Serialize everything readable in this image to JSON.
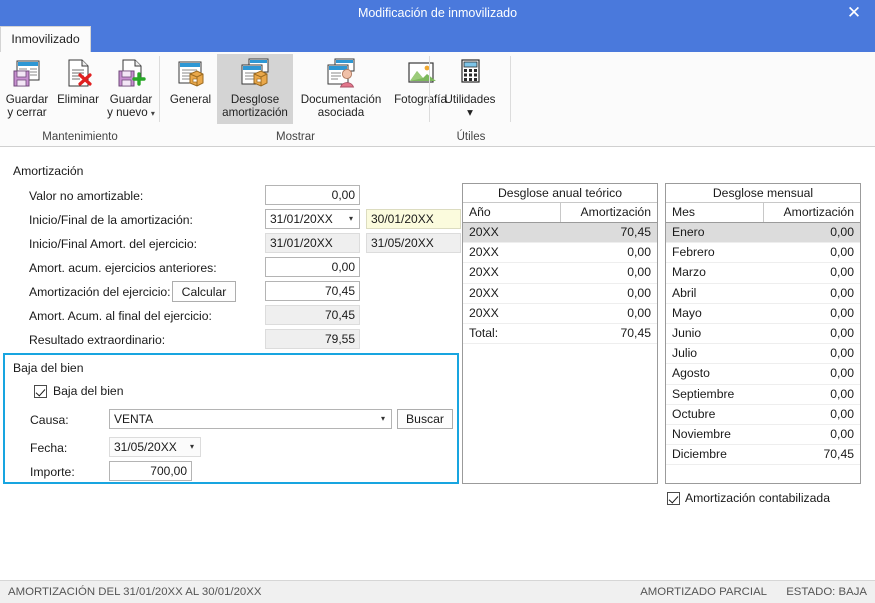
{
  "window": {
    "title": "Modificación de inmovilizado",
    "close_label": "✕"
  },
  "tabs": [
    {
      "label": "Inmovilizado",
      "active": true
    }
  ],
  "ribbon": {
    "groups": [
      {
        "label": "Mantenimiento",
        "buttons": [
          {
            "label_line1": "Guardar",
            "label_line2": "y cerrar",
            "icon": "save-close-icon",
            "selected": false,
            "dropdown": false
          },
          {
            "label_line1": "Eliminar",
            "label_line2": "",
            "icon": "delete-document-icon",
            "selected": false,
            "dropdown": false
          },
          {
            "label_line1": "Guardar",
            "label_line2": "y nuevo",
            "icon": "save-new-icon",
            "selected": false,
            "dropdown": true
          }
        ]
      },
      {
        "label": "Mostrar",
        "buttons": [
          {
            "label_line1": "General",
            "label_line2": "",
            "icon": "general-box-icon",
            "selected": false,
            "dropdown": false
          },
          {
            "label_line1": "Desglose",
            "label_line2": "amortización",
            "icon": "amortization-breakdown-icon",
            "selected": true,
            "dropdown": false
          },
          {
            "label_line1": "Documentación",
            "label_line2": "asociada",
            "icon": "associated-docs-icon",
            "selected": false,
            "dropdown": false
          },
          {
            "label_line1": "Fotografía",
            "label_line2": "",
            "icon": "photo-icon",
            "selected": false,
            "dropdown": false
          }
        ]
      },
      {
        "label": "Útiles",
        "buttons": [
          {
            "label_line1": "Utilidades",
            "label_line2": "",
            "icon": "calculator-icon",
            "selected": false,
            "dropdown": true
          }
        ]
      }
    ]
  },
  "form": {
    "section_title": "Amortización",
    "rows": [
      {
        "label": "Valor no amortizable:",
        "value": "0,00"
      },
      {
        "label": "Inicio/Final de la amortización:",
        "value": "31/01/20XX",
        "value2": "30/01/20XX"
      },
      {
        "label": "Inicio/Final Amort. del ejercicio:",
        "value": "31/01/20XX",
        "value2": "31/05/20XX"
      },
      {
        "label": "Amort. acum. ejercicios anteriores:",
        "value": "0,00"
      },
      {
        "label": "Amortización del ejercicio:",
        "value": "70,45",
        "button": "Calcular"
      },
      {
        "label": "Amort. Acum. al final del ejercicio:",
        "value": "70,45"
      },
      {
        "label": "Resultado extraordinario:",
        "value": "79,55"
      }
    ]
  },
  "baja": {
    "title": "Baja del bien",
    "checkbox_label": "Baja del bien",
    "checkbox_checked": true,
    "causa_label": "Causa:",
    "causa_value": "VENTA",
    "buscar_label": "Buscar",
    "fecha_label": "Fecha:",
    "fecha_value": "31/05/20XX",
    "importe_label": "Importe:",
    "importe_value": "700,00"
  },
  "annual_table": {
    "title": "Desglose anual teórico",
    "columns": [
      "Año",
      "Amortización"
    ],
    "rows": [
      {
        "c0": "20XX",
        "c1": "70,45",
        "selected": true
      },
      {
        "c0": "20XX",
        "c1": "0,00",
        "selected": false
      },
      {
        "c0": "20XX",
        "c1": "0,00",
        "selected": false
      },
      {
        "c0": "20XX",
        "c1": "0,00",
        "selected": false
      },
      {
        "c0": "20XX",
        "c1": "0,00",
        "selected": false
      },
      {
        "c0": "Total:",
        "c1": "70,45",
        "selected": false
      }
    ]
  },
  "monthly_table": {
    "title": "Desglose mensual",
    "columns": [
      "Mes",
      "Amortización"
    ],
    "rows": [
      {
        "c0": "Enero",
        "c1": "0,00",
        "selected": true
      },
      {
        "c0": "Febrero",
        "c1": "0,00",
        "selected": false
      },
      {
        "c0": "Marzo",
        "c1": "0,00",
        "selected": false
      },
      {
        "c0": "Abril",
        "c1": "0,00",
        "selected": false
      },
      {
        "c0": "Mayo",
        "c1": "0,00",
        "selected": false
      },
      {
        "c0": "Junio",
        "c1": "0,00",
        "selected": false
      },
      {
        "c0": "Julio",
        "c1": "0,00",
        "selected": false
      },
      {
        "c0": "Agosto",
        "c1": "0,00",
        "selected": false
      },
      {
        "c0": "Septiembre",
        "c1": "0,00",
        "selected": false
      },
      {
        "c0": "Octubre",
        "c1": "0,00",
        "selected": false
      },
      {
        "c0": "Noviembre",
        "c1": "0,00",
        "selected": false
      },
      {
        "c0": "Diciembre",
        "c1": "70,45",
        "selected": false
      }
    ]
  },
  "accounted": {
    "label": "Amortización contabilizada",
    "checked": true
  },
  "statusbar": {
    "left": "AMORTIZACIÓN DEL 31/01/20XX AL 30/01/20XX",
    "middle": "AMORTIZADO PARCIAL",
    "right": "ESTADO: BAJA"
  },
  "colors": {
    "title_bar": "#4a79dc",
    "highlight_border": "#18a5e0",
    "selected_row": "#dcdcdc",
    "highlight_field": "#fbfbdd"
  }
}
